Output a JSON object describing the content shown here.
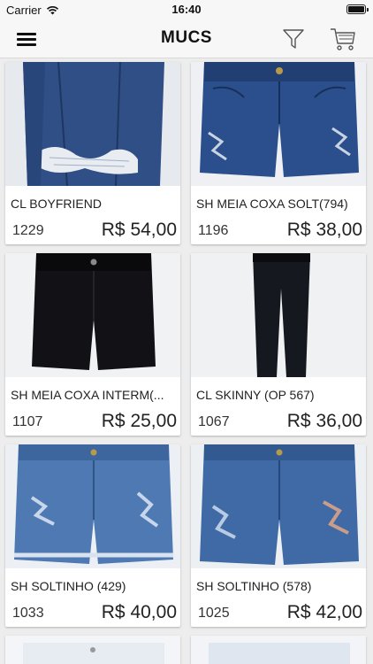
{
  "status_bar": {
    "carrier": "Carrier",
    "time": "16:40"
  },
  "header": {
    "title": "MUCS"
  },
  "products": [
    {
      "name": "CL BOYFRIEND",
      "code": "1229",
      "price": "R$ 54,00",
      "image": "dark-blue-ripped-jeans-closeup"
    },
    {
      "name": "SH MEIA COXA SOLT(794)",
      "code": "1196",
      "price": "R$ 38,00",
      "image": "dark-blue-ripped-shorts"
    },
    {
      "name": "SH MEIA COXA INTERM(...",
      "code": "1107",
      "price": "R$ 25,00",
      "image": "black-shorts"
    },
    {
      "name": "CL SKINNY (OP 567)",
      "code": "1067",
      "price": "R$ 36,00",
      "image": "black-skinny-jeans"
    },
    {
      "name": "SH SOLTINHO (429)",
      "code": "1033",
      "price": "R$ 40,00",
      "image": "light-blue-distressed-shorts"
    },
    {
      "name": "SH SOLTINHO (578)",
      "code": "1025",
      "price": "R$ 42,00",
      "image": "medium-blue-distressed-shorts"
    }
  ],
  "colors": {
    "bar_background": "#f7f7f7",
    "page_background": "#ededed",
    "card_background": "#ffffff"
  }
}
